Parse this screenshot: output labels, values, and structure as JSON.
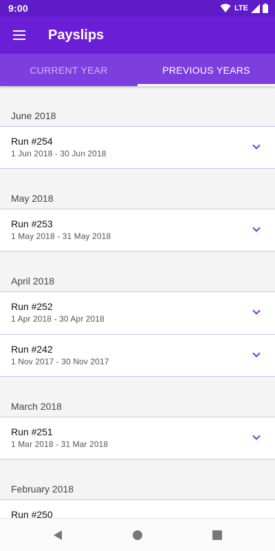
{
  "status": {
    "time": "9:00",
    "network": "LTE"
  },
  "app": {
    "title": "Payslips"
  },
  "tabs": [
    {
      "label": "CURRENT YEAR",
      "active": false
    },
    {
      "label": "PREVIOUS YEARS",
      "active": true
    }
  ],
  "sections": [
    {
      "header": "June 2018",
      "items": [
        {
          "title": "Run #254",
          "range": "1 Jun 2018  -  30 Jun 2018"
        }
      ]
    },
    {
      "header": "May 2018",
      "items": [
        {
          "title": "Run #253",
          "range": "1 May 2018  -  31 May 2018"
        }
      ]
    },
    {
      "header": "April 2018",
      "items": [
        {
          "title": "Run #252",
          "range": "1 Apr 2018  -  30 Apr 2018"
        },
        {
          "title": "Run #242",
          "range": "1 Nov 2017  -  30 Nov 2017"
        }
      ]
    },
    {
      "header": "March 2018",
      "items": [
        {
          "title": "Run #251",
          "range": "1 Mar 2018  -  31 Mar 2018"
        }
      ]
    },
    {
      "header": "February 2018",
      "items": [
        {
          "title": "Run #250",
          "range": ""
        }
      ]
    }
  ],
  "colors": {
    "primary": "#6a1fd6",
    "status_bar": "#5e1bc7",
    "tabs_bg": "#7d3ee0",
    "accent": "#7b2fe0",
    "divider": "#c9c2f2"
  },
  "icons": {
    "menu": "hamburger-icon",
    "expand": "chevron-down-icon",
    "wifi": "wifi-icon",
    "signal": "signal-icon",
    "battery": "battery-icon",
    "back": "back-triangle-icon",
    "home": "home-circle-icon",
    "recents": "recents-square-icon"
  }
}
